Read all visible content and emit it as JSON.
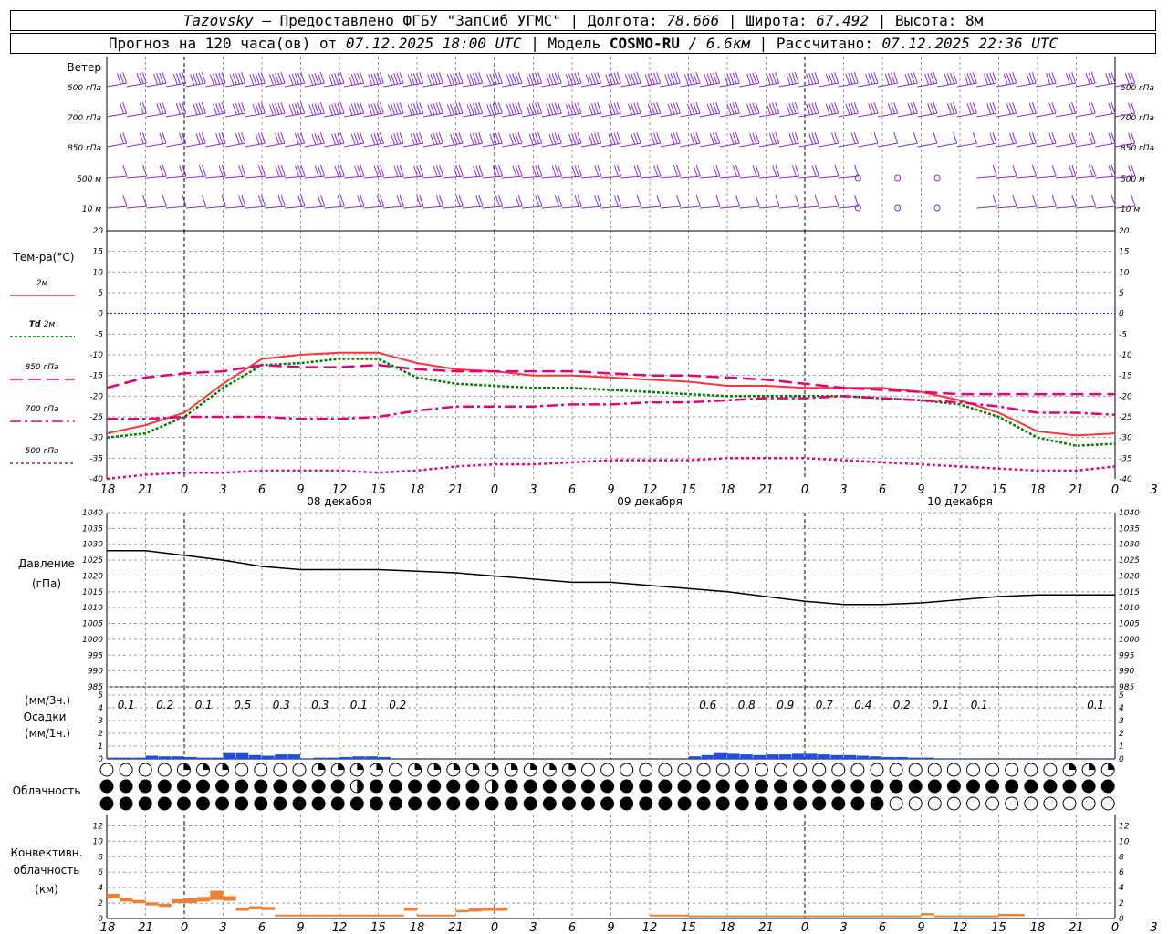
{
  "header": {
    "line1": {
      "station": "Tazovsky",
      "provider": " – Предоставлено ФГБУ \"ЗапСиб УГМС\" | ",
      "lon_label": "Долгота: ",
      "lon": "78.666",
      "lat_label": " | Широта: ",
      "lat": "67.492",
      "alt_label": " | Высота: ",
      "alt": "8м"
    },
    "line2": {
      "prefix": "Прогноз на 120 часа(ов) от ",
      "start": "07.12.2025 18:00 UTC",
      "model_label": " | Модель ",
      "model": "COSMO-RU",
      "res": " / 6.6км",
      "calc_label": " | Рассчитано: ",
      "calc": "07.12.2025 22:36 UTC"
    }
  },
  "labels": {
    "wind_title": "Ветер",
    "wind_levels": [
      "500 гПа",
      "700 гПа",
      "850 гПа",
      "500 м",
      "10 м"
    ],
    "temp_title": "Тем-ра(°С)",
    "temp_legend": [
      {
        "prefix": "",
        "text": "2м",
        "color": "#ff3333",
        "dash": ""
      },
      {
        "prefix": "Td",
        "text": "2м",
        "color": "#008000",
        "dash": "3,2"
      },
      {
        "prefix": "",
        "text": "850 гПа",
        "color": "#e6007e",
        "dash": "14,6"
      },
      {
        "prefix": "",
        "text": "700 гПа",
        "color": "#e6007e",
        "dash": "12,4,3,4"
      },
      {
        "prefix": "",
        "text": "500 гПа",
        "color": "#e6007e",
        "dash": "3,3"
      }
    ],
    "pressure_title": "Давление",
    "pressure_unit": "(гПа)",
    "precip_3h": "(мм/3ч.)",
    "precip_title": "Осадки",
    "precip_1h": "(мм/1ч.)",
    "cloud_title": "Облачность",
    "conv_title": "Конвективн.",
    "conv_title2": "облачность",
    "conv_unit": "(км)"
  },
  "time_axis": [
    "18",
    "21",
    "0",
    "3",
    "6",
    "9",
    "12",
    "15",
    "18",
    "21",
    "0",
    "3",
    "6",
    "9",
    "12",
    "15",
    "18",
    "21",
    "0",
    "3",
    "6",
    "9",
    "12",
    "15",
    "18",
    "21",
    "0",
    "3",
    "6",
    "9",
    "12",
    "15",
    "18",
    "21",
    "0"
  ],
  "day_labels": [
    {
      "text": "08 декабря",
      "hour": 18
    },
    {
      "text": "09 декабря",
      "hour": 42
    },
    {
      "text": "10 декабря",
      "hour": 66
    }
  ],
  "chart_data": [
    {
      "type": "line",
      "title": "Тем-ра(°С)",
      "x_hours_from_start": [
        0,
        3,
        6,
        9,
        12,
        15,
        18,
        21,
        24,
        27,
        30,
        33,
        36,
        39,
        42,
        45,
        48,
        51,
        54,
        57,
        60,
        63,
        66,
        69,
        72,
        75,
        78
      ],
      "x_range": [
        0,
        78
      ],
      "ylim": [
        -40,
        20
      ],
      "yticks": [
        -40,
        -35,
        -30,
        -25,
        -20,
        -15,
        -10,
        -5,
        0,
        5,
        10,
        15,
        20
      ],
      "series": [
        {
          "name": "2м",
          "color": "#ff3333",
          "values": [
            -29,
            -27,
            -24,
            -17,
            -11,
            -10,
            -9.5,
            -9.5,
            -12,
            -13.5,
            -14,
            -15,
            -15,
            -15.5,
            -16,
            -16.5,
            -17.5,
            -17.5,
            -18,
            -18,
            -18,
            -19,
            -21,
            -24,
            -28.5,
            -29.5,
            -29
          ]
        },
        {
          "name": "Td 2м",
          "color": "#008000",
          "values": [
            -30,
            -29,
            -25,
            -18,
            -12.5,
            -12,
            -11,
            -11,
            -15.5,
            -17,
            -17.5,
            -18,
            -18,
            -18.5,
            -19,
            -19.5,
            -20,
            -20,
            -20,
            -20,
            -20.5,
            -21,
            -22,
            -25,
            -30,
            -32,
            -31.5
          ]
        },
        {
          "name": "850 гПа",
          "color": "#e6007e",
          "values": [
            -18,
            -15.5,
            -14.5,
            -14,
            -12.5,
            -13,
            -13,
            -12.5,
            -13.5,
            -14,
            -14,
            -14,
            -14,
            -14.5,
            -15,
            -15,
            -15.5,
            -16,
            -17,
            -18,
            -18.5,
            -19,
            -19.5,
            -19.5,
            -19.5,
            -19.5,
            -19.5
          ]
        },
        {
          "name": "700 гПа",
          "color": "#e6007e",
          "values": [
            -25.5,
            -25.5,
            -25,
            -25,
            -25,
            -25.5,
            -25.5,
            -25,
            -23.5,
            -22.5,
            -22.5,
            -22.5,
            -22,
            -22,
            -21.5,
            -21.5,
            -21,
            -20.5,
            -20.5,
            -20,
            -20.5,
            -21,
            -21.5,
            -22.5,
            -24,
            -24,
            -24.5
          ]
        },
        {
          "name": "500 гПа",
          "color": "#e6007e",
          "values": [
            -40,
            -39,
            -38.5,
            -38.5,
            -38,
            -38,
            -38,
            -38.5,
            -38,
            -37,
            -36.5,
            -36.5,
            -36,
            -35.5,
            -35.5,
            -35.5,
            -35,
            -35,
            -35,
            -35.5,
            -36,
            -36.5,
            -37,
            -37.5,
            -38,
            -38,
            -37
          ]
        }
      ]
    },
    {
      "type": "line",
      "title": "Давление",
      "ylabel": "(гПа)",
      "x_hours_from_start": [
        0,
        3,
        6,
        9,
        12,
        15,
        18,
        21,
        24,
        27,
        30,
        33,
        36,
        39,
        42,
        45,
        48,
        51,
        54,
        57,
        60,
        63,
        66,
        69,
        72,
        75,
        78
      ],
      "x_range": [
        0,
        78
      ],
      "ylim": [
        985,
        1040
      ],
      "yticks": [
        985,
        990,
        995,
        1000,
        1005,
        1010,
        1015,
        1020,
        1025,
        1030,
        1035,
        1040
      ],
      "series": [
        {
          "name": "",
          "color": "#000000",
          "values": [
            1028,
            1028,
            1026.5,
            1025,
            1023,
            1022,
            1022,
            1022,
            1021.5,
            1021,
            1020,
            1019,
            1018,
            1018,
            1017,
            1016,
            1015,
            1013.5,
            1012,
            1011,
            1011,
            1011.5,
            1012.5,
            1013.5,
            1014,
            1014,
            1014
          ]
        }
      ]
    },
    {
      "type": "bar",
      "title": "Осадки",
      "ylabel": "(мм/1ч.)",
      "ylim": [
        0,
        5
      ],
      "yticks": [
        0,
        1,
        2,
        3,
        4,
        5
      ],
      "bar_start_hour": [
        0,
        1,
        2,
        3,
        4,
        5,
        6,
        7,
        8,
        9,
        10,
        11,
        12,
        13,
        14,
        15,
        16,
        17,
        18,
        19,
        20,
        21,
        22,
        23,
        24,
        25,
        26,
        27,
        28,
        29,
        30,
        31,
        32,
        33,
        34,
        35,
        36,
        37,
        38,
        39,
        40,
        41,
        42,
        43,
        44,
        45,
        46,
        47,
        48,
        49,
        50,
        51,
        52,
        53,
        54,
        55,
        56,
        57,
        58,
        59,
        60,
        61,
        62,
        63,
        64,
        65,
        66,
        67,
        68,
        69,
        70,
        71,
        72,
        73,
        74,
        75,
        76,
        77
      ],
      "values_mm_per_1h": [
        0.1,
        0.1,
        0.1,
        0.25,
        0.2,
        0.2,
        0.15,
        0.1,
        0.1,
        0.45,
        0.45,
        0.3,
        0.25,
        0.35,
        0.35,
        0.05,
        0.1,
        0.1,
        0.15,
        0.2,
        0.2,
        0.15,
        0.05,
        0,
        0,
        0,
        0.05,
        0,
        0,
        0,
        0,
        0,
        0,
        0,
        0,
        0,
        0,
        0,
        0,
        0,
        0,
        0,
        0,
        0,
        0,
        0.2,
        0.3,
        0.45,
        0.4,
        0.35,
        0.3,
        0.35,
        0.35,
        0.4,
        0.4,
        0.35,
        0.3,
        0.3,
        0.25,
        0.2,
        0.15,
        0.15,
        0.1,
        0.1,
        0.05,
        0.05,
        0.05,
        0.05,
        0,
        0,
        0.05,
        0.05,
        0,
        0,
        0,
        0,
        0.05,
        0.05
      ],
      "totals_3h": [
        {
          "hour": 1.5,
          "value": "0.1"
        },
        {
          "hour": 4.5,
          "value": "0.2"
        },
        {
          "hour": 7.5,
          "value": "0.1"
        },
        {
          "hour": 10.5,
          "value": "0.5"
        },
        {
          "hour": 13.5,
          "value": "0.3"
        },
        {
          "hour": 16.5,
          "value": "0.3"
        },
        {
          "hour": 19.5,
          "value": "0.1"
        },
        {
          "hour": 22.5,
          "value": "0.2"
        },
        {
          "hour": 46.5,
          "value": "0.6"
        },
        {
          "hour": 49.5,
          "value": "0.8"
        },
        {
          "hour": 52.5,
          "value": "0.9"
        },
        {
          "hour": 55.5,
          "value": "0.7"
        },
        {
          "hour": 58.5,
          "value": "0.4"
        },
        {
          "hour": 61.5,
          "value": "0.2"
        },
        {
          "hour": 64.5,
          "value": "0.1"
        },
        {
          "hour": 67.5,
          "value": "0.1"
        },
        {
          "hour": 76.5,
          "value": "0.1"
        }
      ]
    },
    {
      "type": "bar",
      "title": "Конвективн. облачность",
      "ylabel": "(км)",
      "ylim": [
        0,
        13
      ],
      "yticks": [
        0,
        2,
        4,
        6,
        8,
        10,
        12
      ],
      "segments": [
        {
          "from": 0,
          "to": 1,
          "base": 2.6,
          "top": 3.2
        },
        {
          "from": 1,
          "to": 2,
          "base": 2.2,
          "top": 2.7
        },
        {
          "from": 2,
          "to": 3,
          "base": 2.0,
          "top": 2.4
        },
        {
          "from": 3,
          "to": 4,
          "base": 1.7,
          "top": 2.1
        },
        {
          "from": 4,
          "to": 5,
          "base": 1.5,
          "top": 1.9
        },
        {
          "from": 5,
          "to": 6,
          "base": 2.0,
          "top": 2.5
        },
        {
          "from": 6,
          "to": 7,
          "base": 2.0,
          "top": 2.6
        },
        {
          "from": 7,
          "to": 8,
          "base": 2.2,
          "top": 2.8
        },
        {
          "from": 8,
          "to": 9,
          "base": 2.4,
          "top": 3.6
        },
        {
          "from": 9,
          "to": 10,
          "base": 2.3,
          "top": 2.9
        },
        {
          "from": 10,
          "to": 11,
          "base": 1.0,
          "top": 1.4
        },
        {
          "from": 11,
          "to": 12,
          "base": 1.2,
          "top": 1.6
        },
        {
          "from": 12,
          "to": 13,
          "base": 1.1,
          "top": 1.5
        },
        {
          "from": 13,
          "to": 23,
          "base": 0.3,
          "top": 0.5
        },
        {
          "from": 23,
          "to": 24,
          "base": 1.0,
          "top": 1.4
        },
        {
          "from": 24,
          "to": 27,
          "base": 0.3,
          "top": 0.5
        },
        {
          "from": 27,
          "to": 28,
          "base": 0.8,
          "top": 1.1
        },
        {
          "from": 28,
          "to": 29,
          "base": 0.9,
          "top": 1.3
        },
        {
          "from": 29,
          "to": 30,
          "base": 1.0,
          "top": 1.4
        },
        {
          "from": 30,
          "to": 31,
          "base": 1.0,
          "top": 1.4
        },
        {
          "from": 42,
          "to": 45,
          "base": 0.3,
          "top": 0.5
        },
        {
          "from": 45,
          "to": 63,
          "base": 0.2,
          "top": 0.4
        },
        {
          "from": 63,
          "to": 64,
          "base": 0.4,
          "top": 0.7
        },
        {
          "from": 64,
          "to": 69,
          "base": 0.2,
          "top": 0.4
        },
        {
          "from": 69,
          "to": 71,
          "base": 0.3,
          "top": 0.6
        }
      ],
      "color": "#f08030"
    }
  ],
  "clouds": {
    "rows": [
      "0000ooo0000oooo0ooooooooo0000000000000000000000000ooohhhhhhhhhhhhhhhhhhhhhhhhoo00000000000000000",
      "fffffffffffffhffffffhfffffffffffffffffffffffffffffffffffffffffffffffffffffffffffffffffffffffffffff",
      "fffffffffffffffffffffffffffffffffffffffff0000000000000000hfffffffffffffffffffffffffffffffffffffffffffffff"
    ]
  },
  "winds": {
    "levels": [
      "500 гПа",
      "700 гПа",
      "850 гПа",
      "500 м",
      "10 м"
    ],
    "speed_kt_per_level": [
      [
        25,
        35,
        45,
        45,
        50,
        55,
        55,
        60,
        60,
        60,
        55,
        55,
        50,
        45,
        45,
        45,
        40,
        40,
        40,
        35,
        35,
        35,
        35,
        30,
        30,
        25
      ],
      [
        20,
        30,
        35,
        40,
        45,
        45,
        50,
        50,
        50,
        45,
        45,
        45,
        40,
        40,
        40,
        40,
        35,
        35,
        35,
        30,
        25,
        25,
        25,
        20,
        20,
        20
      ],
      [
        15,
        20,
        25,
        30,
        30,
        35,
        35,
        35,
        35,
        35,
        35,
        35,
        35,
        30,
        30,
        30,
        30,
        25,
        20,
        10,
        5,
        10,
        15,
        15,
        20,
        20
      ],
      [
        10,
        15,
        20,
        20,
        25,
        25,
        25,
        25,
        25,
        25,
        25,
        25,
        20,
        20,
        20,
        20,
        20,
        15,
        10,
        0,
        0,
        0,
        5,
        10,
        15,
        15
      ],
      [
        5,
        10,
        10,
        15,
        15,
        15,
        15,
        15,
        15,
        15,
        15,
        15,
        15,
        10,
        10,
        10,
        10,
        10,
        5,
        0,
        0,
        0,
        5,
        5,
        10,
        10
      ]
    ]
  },
  "colors": {
    "wind": "#8a2be2",
    "grid": "#999999",
    "zero_line": "#0000ff",
    "precip": "#1f4fe0",
    "conv": "#f08030"
  }
}
